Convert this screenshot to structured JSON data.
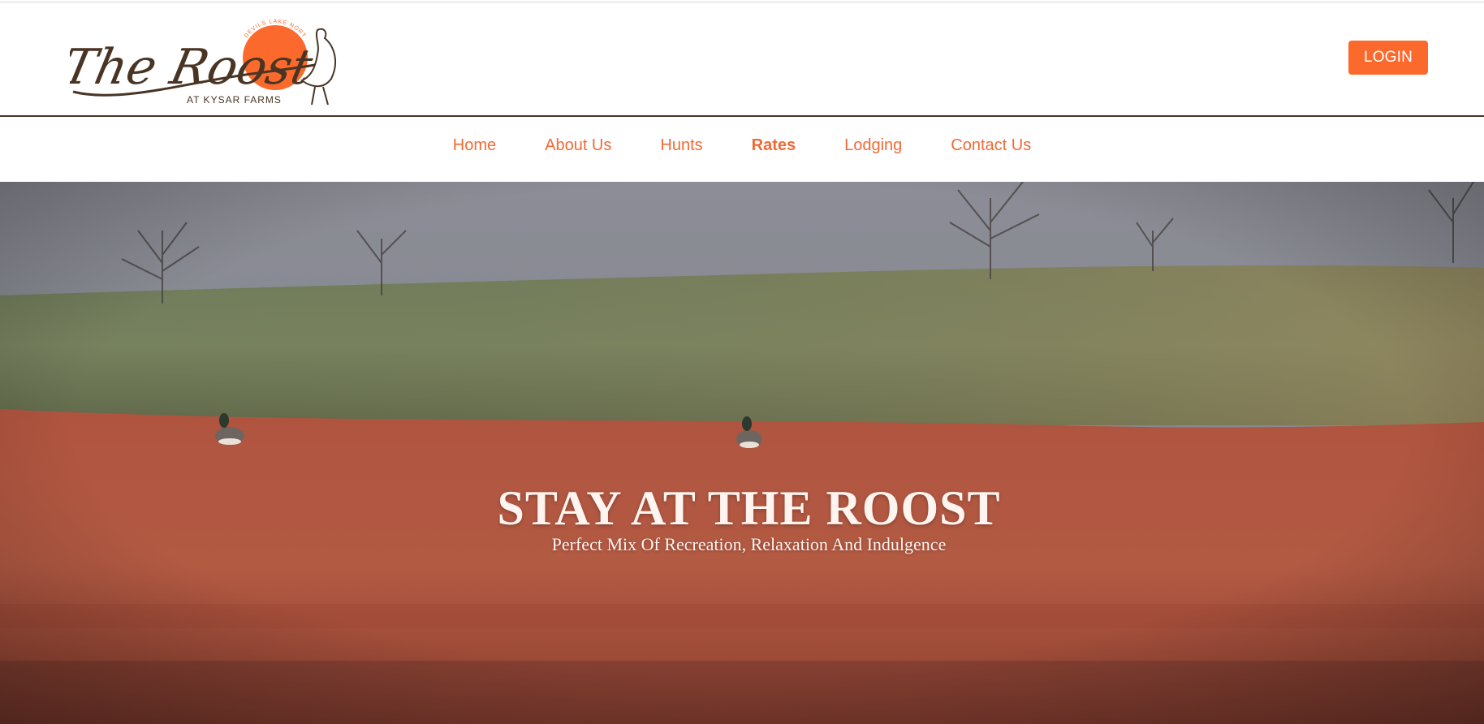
{
  "header": {
    "logo": {
      "script_text": "The Roost",
      "tagline": "AT KYSAR FARMS",
      "arc_text": "DEVILS LAKE NORTH DAKOTA"
    },
    "login_label": "LOGIN"
  },
  "nav": {
    "items": [
      {
        "label": "Home",
        "active": false
      },
      {
        "label": "About Us",
        "active": false
      },
      {
        "label": "Hunts",
        "active": false
      },
      {
        "label": "Rates",
        "active": true
      },
      {
        "label": "Lodging",
        "active": false
      },
      {
        "label": "Contact Us",
        "active": false
      }
    ]
  },
  "hero": {
    "title": "STAY AT THE ROOST",
    "subtitle": "Perfect Mix Of Recreation, Relaxation And Indulgence"
  },
  "colors": {
    "accent": "#fb6a2c",
    "nav_text": "#f06a36",
    "brand_brown": "#4a3524"
  }
}
